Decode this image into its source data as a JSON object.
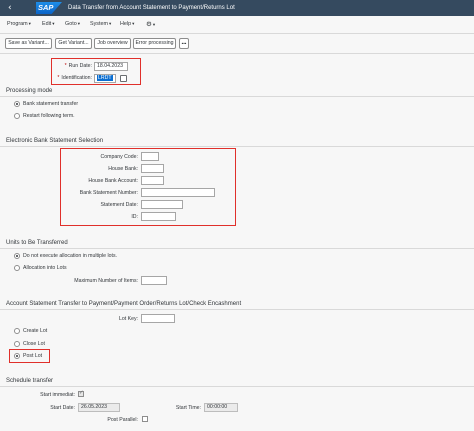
{
  "header": {
    "back_icon": "chevron-left-icon",
    "logo": "SAP",
    "title": "Data Transfer from Account Statement to Payment/Returns Lot"
  },
  "menu": [
    {
      "label": "Program"
    },
    {
      "label": "Edit"
    },
    {
      "label": "Goto"
    },
    {
      "label": "System"
    },
    {
      "label": "Help"
    }
  ],
  "menu_gear": "gear-icon",
  "toolbar": {
    "save_as_variant": "Save as Variant...",
    "get_variant": "Get Variant...",
    "job_overview": "Job overview",
    "error_processing": "Error processing",
    "more": "•••"
  },
  "header_fields": {
    "run_date_label": "Run Date:",
    "run_date_value": "18.04.2023",
    "identification_label": "Identification:",
    "identification_value": "LRDT"
  },
  "processing_mode": {
    "title": "Processing mode",
    "options": [
      {
        "label": "Bank statement transfer",
        "selected": true
      },
      {
        "label": "Restart following term.",
        "selected": false
      }
    ]
  },
  "ebs_selection": {
    "title": "Electronic Bank Statement Selection",
    "fields": [
      {
        "label": "Company Code:",
        "value": ""
      },
      {
        "label": "House Bank:",
        "value": ""
      },
      {
        "label": "House Bank Account:",
        "value": ""
      },
      {
        "label": "Bank Statement Number:",
        "value": ""
      },
      {
        "label": "Statement Date:",
        "value": ""
      },
      {
        "label": "ID:",
        "value": ""
      }
    ]
  },
  "units": {
    "title": "Units to Be Transferred",
    "options": [
      {
        "label": "Do not execute allocation in multiple lots.",
        "selected": true
      },
      {
        "label": "Allocation into Lots",
        "selected": false
      }
    ],
    "max_items_label": "Maximum Number of Items:",
    "max_items_value": ""
  },
  "transfer": {
    "title": "Account Statement Transfer to Payment/Payment Order/Returns Lot/Check Encashment",
    "lot_key_label": "Lot Key:",
    "lot_key_value": "",
    "options": [
      {
        "label": "Create Lot",
        "selected": false
      },
      {
        "label": "Close Lot",
        "selected": false
      },
      {
        "label": "Post Lot",
        "selected": true
      }
    ]
  },
  "schedule": {
    "title": "Schedule transfer",
    "start_immediat_label": "Start immediat:",
    "start_immediat_checked": true,
    "start_date_label": "Start Date:",
    "start_date_value": "26.05.2023",
    "start_time_label": "Start Time:",
    "start_time_value": "00:00:00",
    "post_parallel_label": "Post Parallel:",
    "post_parallel_checked": false
  },
  "colors": {
    "shell": "#354a5f",
    "highlight": "#e0302b",
    "selection": "#0a6ed1"
  }
}
